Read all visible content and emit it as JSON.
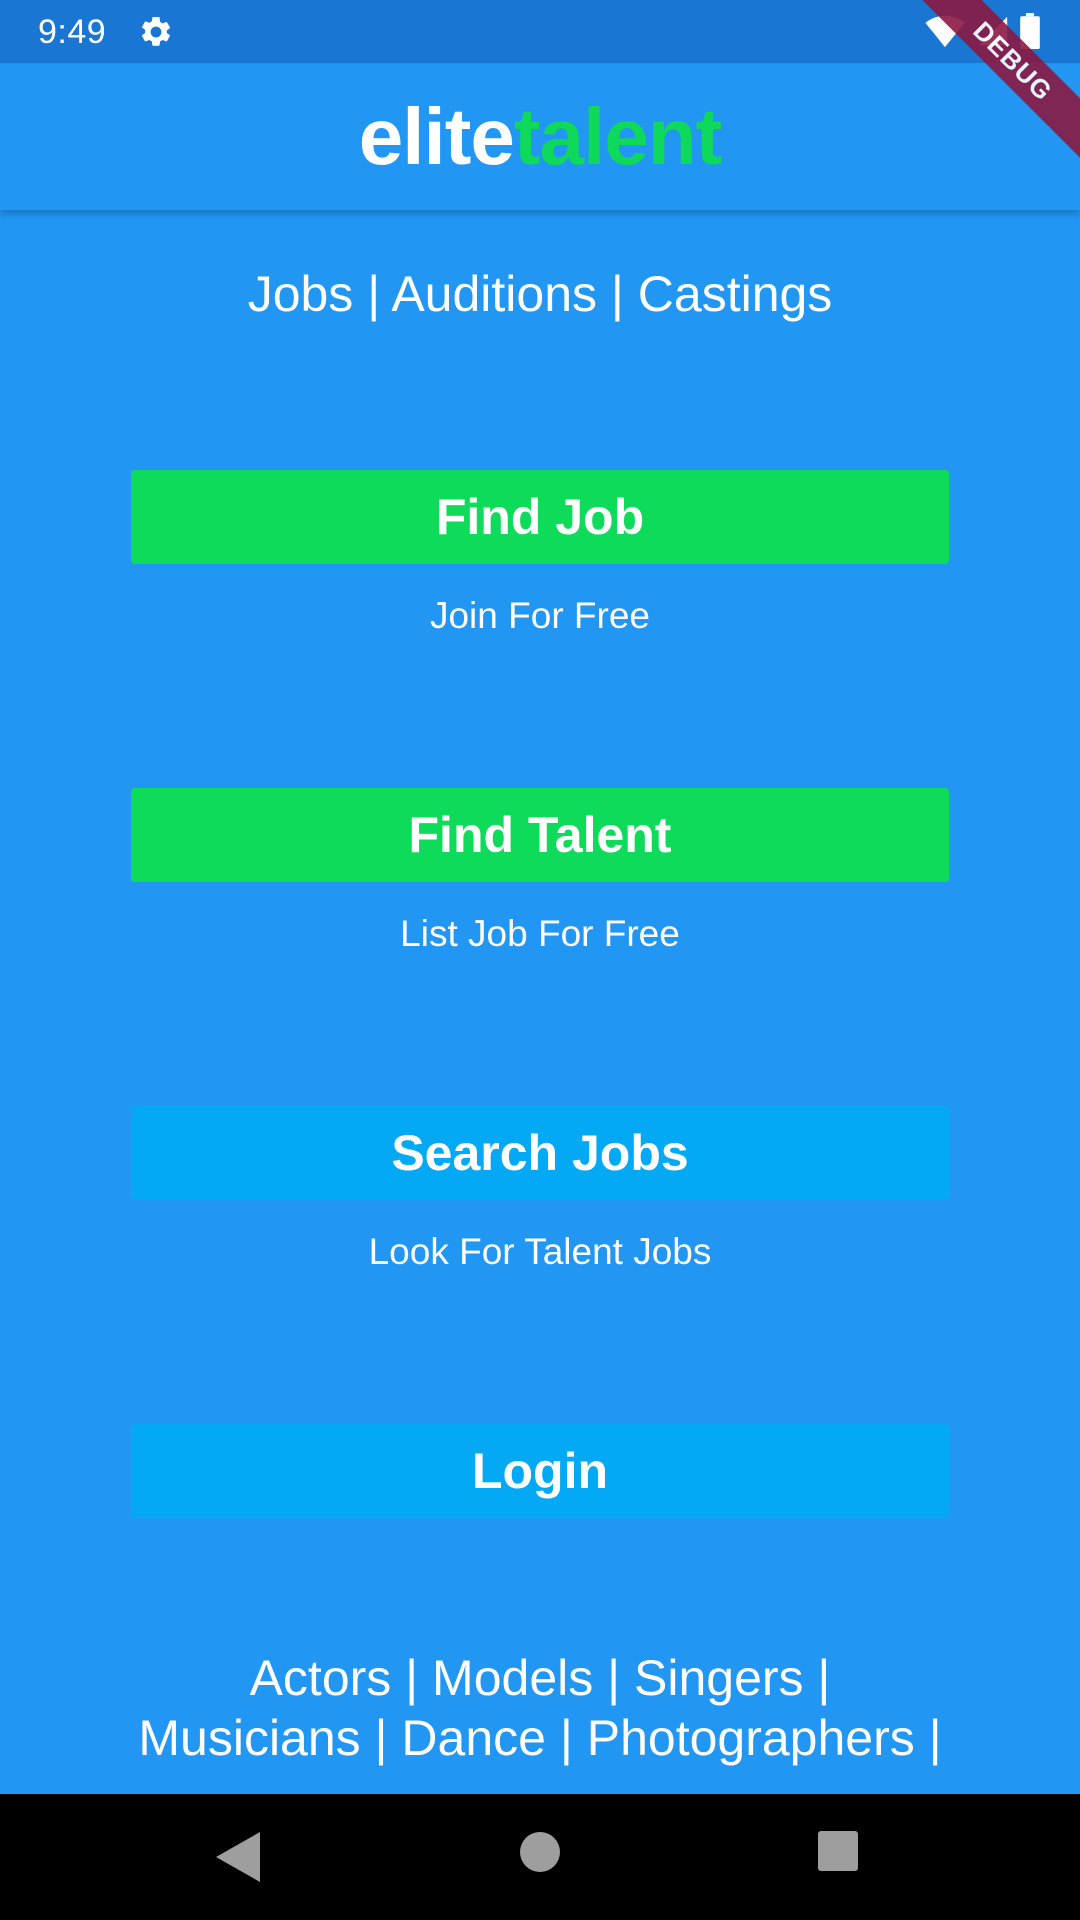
{
  "status_bar": {
    "time": "9:49",
    "icons": [
      "gear-icon",
      "wifi-icon",
      "signal-icon",
      "battery-icon"
    ]
  },
  "app_bar": {
    "brand_part1": "elite",
    "brand_part2": "talent",
    "debug_banner": "DEBUG"
  },
  "tagline": "Jobs | Auditions | Castings",
  "actions": [
    {
      "label": "Find Job",
      "caption": "Join For Free"
    },
    {
      "label": "Find Talent",
      "caption": "List Job For Free"
    },
    {
      "label": "Search Jobs",
      "caption": "Look For Talent Jobs"
    },
    {
      "label": "Login"
    }
  ],
  "categories": {
    "line1": "Actors | Models | Singers |",
    "line2": "Musicians | Dance | Photographers |"
  },
  "colors": {
    "background": "#2196F3",
    "status_bar": "#1976D2",
    "brand_accent": "#0FD95A",
    "primary_button": "#0FDB5B",
    "secondary_button": "#03A9F4",
    "debug_ribbon": "#8B1A44"
  },
  "nav_bar": {
    "icons": [
      "back-icon",
      "home-icon",
      "recents-icon"
    ]
  }
}
